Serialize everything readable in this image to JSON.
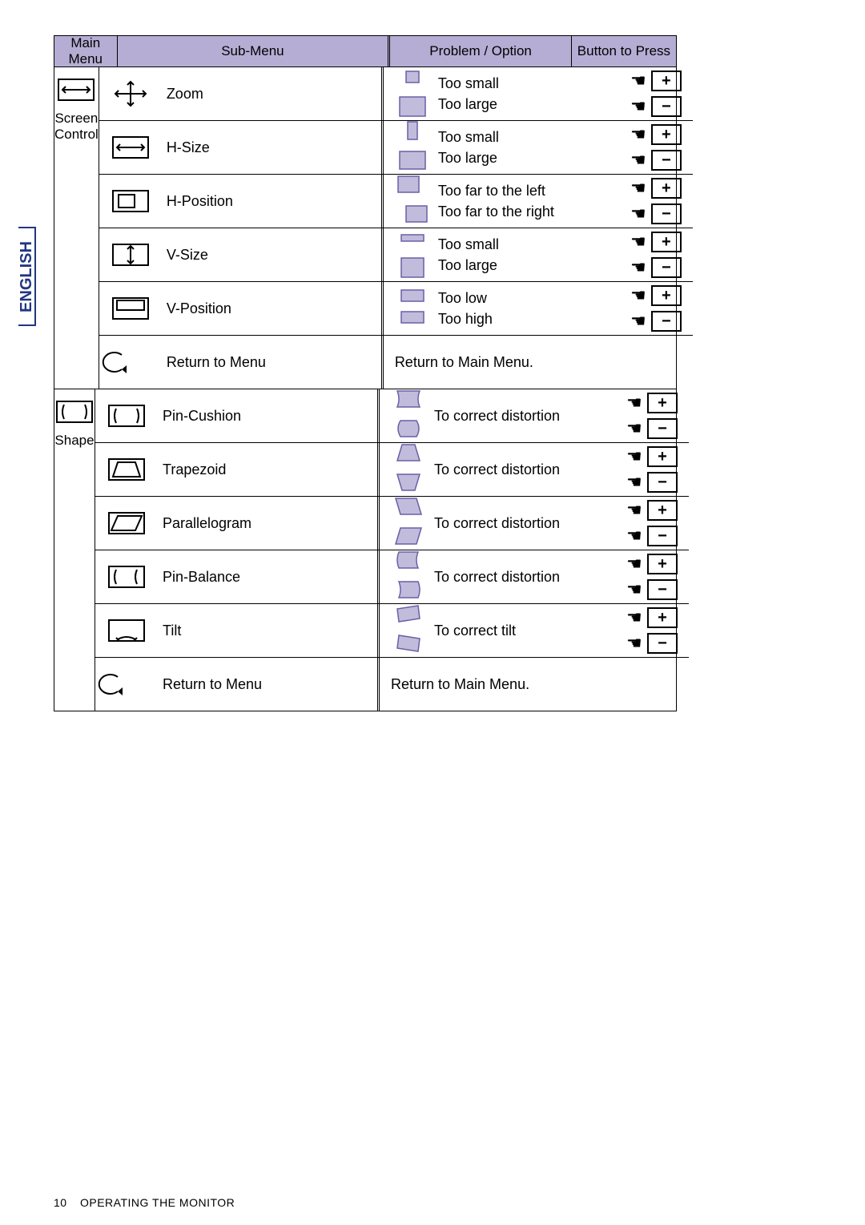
{
  "language_tab": "ENGLISH",
  "headers": {
    "main": "Main Menu",
    "sub": "Sub-Menu",
    "problem": "Problem / Option",
    "button": "Button to Press"
  },
  "sections": [
    {
      "main_label": "Screen\nControl",
      "main_icon": "screen-control-icon",
      "rows": [
        {
          "sub_icon": "zoom-icon",
          "sub_label": "Zoom",
          "problems": [
            "Too small",
            "Too large"
          ],
          "buttons": [
            "plus",
            "minus"
          ],
          "prob_icons": [
            "sq-small",
            "sq-large"
          ]
        },
        {
          "sub_icon": "hsize-icon",
          "sub_label": "H-Size",
          "problems": [
            "Too small",
            "Too large"
          ],
          "buttons": [
            "plus",
            "minus"
          ],
          "prob_icons": [
            "rect-narrow",
            "rect-wide"
          ]
        },
        {
          "sub_icon": "hpos-icon",
          "sub_label": "H-Position",
          "problems": [
            "Too far to the left",
            "Too far to the right"
          ],
          "buttons": [
            "plus",
            "minus"
          ],
          "prob_icons": [
            "rect-left",
            "rect-right"
          ]
        },
        {
          "sub_icon": "vsize-icon",
          "sub_label": "V-Size",
          "problems": [
            "Too small",
            "Too large"
          ],
          "buttons": [
            "plus",
            "minus"
          ],
          "prob_icons": [
            "rect-short",
            "rect-tall"
          ]
        },
        {
          "sub_icon": "vpos-icon",
          "sub_label": "V-Position",
          "problems": [
            "Too  low",
            "Too high"
          ],
          "buttons": [
            "plus",
            "minus"
          ],
          "prob_icons": [
            "rect-low",
            "rect-high"
          ]
        },
        {
          "sub_icon": "return-icon",
          "sub_label": "Return to Menu",
          "problems": [
            "Return to Main Menu."
          ],
          "buttons": [],
          "prob_icons": []
        }
      ]
    },
    {
      "main_label": "Shape",
      "main_icon": "shape-icon",
      "rows": [
        {
          "sub_icon": "pincushion-icon",
          "sub_label": "Pin-Cushion",
          "problems": [
            "To  correct  distortion"
          ],
          "buttons": [
            "plus",
            "minus"
          ],
          "prob_icons": [
            "pincushion-in",
            "pincushion-out"
          ]
        },
        {
          "sub_icon": "trapezoid-icon",
          "sub_label": "Trapezoid",
          "problems": [
            "To  correct  distortion"
          ],
          "buttons": [
            "plus",
            "minus"
          ],
          "prob_icons": [
            "trap-top",
            "trap-bottom"
          ]
        },
        {
          "sub_icon": "parallelogram-icon",
          "sub_label": "Parallelogram",
          "problems": [
            "To  correct  distortion"
          ],
          "buttons": [
            "plus",
            "minus"
          ],
          "prob_icons": [
            "para-left",
            "para-right"
          ]
        },
        {
          "sub_icon": "pinbalance-icon",
          "sub_label": "Pin-Balance",
          "problems": [
            "To  correct  distortion"
          ],
          "buttons": [
            "plus",
            "minus"
          ],
          "prob_icons": [
            "pinbal-left",
            "pinbal-right"
          ]
        },
        {
          "sub_icon": "tilt-icon",
          "sub_label": "Tilt",
          "problems": [
            "To  correct  tilt"
          ],
          "buttons": [
            "plus",
            "minus"
          ],
          "prob_icons": [
            "tilt-left",
            "tilt-right"
          ]
        },
        {
          "sub_icon": "return-icon",
          "sub_label": "Return to Menu",
          "problems": [
            "Return to Main Menu."
          ],
          "buttons": [],
          "prob_icons": []
        }
      ]
    }
  ],
  "footer": {
    "page": "10",
    "title": "OPERATING THE MONITOR"
  }
}
